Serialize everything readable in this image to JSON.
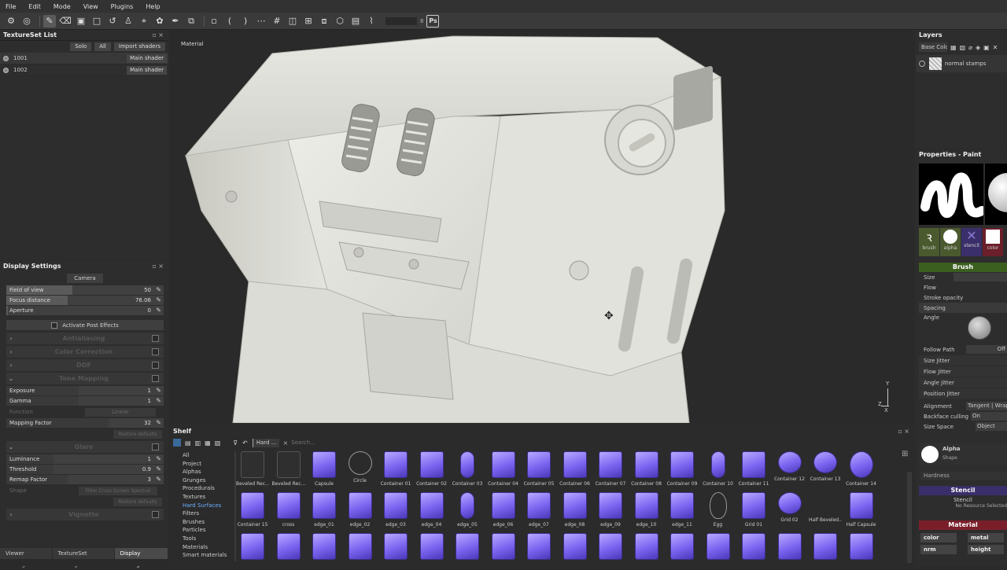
{
  "menu": [
    "File",
    "Edit",
    "Mode",
    "View",
    "Plugins",
    "Help"
  ],
  "toolbar": {
    "ps_label": "Ps",
    "brush_count": "8"
  },
  "textureset": {
    "title": "TextureSet List",
    "solo": "Solo",
    "all": "All",
    "import": "Import shaders",
    "items": [
      {
        "name": "1001",
        "shader": "Main shader"
      },
      {
        "name": "1002",
        "shader": "Main shader"
      }
    ]
  },
  "display": {
    "title": "Display Settings",
    "camera": "Camera",
    "fov": {
      "label": "Field of view",
      "value": "50"
    },
    "focus": {
      "label": "Focus distance",
      "value": "76.06"
    },
    "aperture": {
      "label": "Aperture",
      "value": "0"
    },
    "post_fx": "Activate Post Effects",
    "sections": [
      "Antialiasing",
      "Color Correction",
      "DOF",
      "Tone Mapping"
    ],
    "exposure": {
      "label": "Exposure",
      "value": "1"
    },
    "gamma": {
      "label": "Gamma",
      "value": "1"
    },
    "function_label": "Function",
    "function_value": "Linear",
    "mapping": {
      "label": "Mapping Factor",
      "value": "32"
    },
    "reset1": "Restore defaults",
    "glare": "Glare",
    "luminance": {
      "label": "Luminance",
      "value": "1"
    },
    "threshold": {
      "label": "Threshold",
      "value": "0.9"
    },
    "remap": {
      "label": "Remap Factor",
      "value": "3"
    },
    "shape_label": "Shape",
    "shape_value": "Filter Cross Screen Spectral",
    "reset2": "Restore defaults",
    "vignette": "Vignette"
  },
  "bottom_tabs": [
    "Viewer Settings",
    "TextureSet Settings",
    "Display Settings"
  ],
  "viewport": {
    "label": "Material"
  },
  "shelf": {
    "title": "Shelf",
    "filter": "Hard ...",
    "search_placeholder": "Search...",
    "categories": [
      "All",
      "Project",
      "Alphas",
      "Grunges",
      "Procedurals",
      "Textures",
      "Hard Surfaces",
      "Filters",
      "Brushes",
      "Particles",
      "Tools",
      "Materials",
      "Smart materials"
    ],
    "row1": [
      "Beveled Rec...",
      "Beveled Rec...",
      "Capsule",
      "Circle",
      "Container 01",
      "Container 02",
      "Container 03",
      "Container 04",
      "Container 05",
      "Container 06",
      "Container 07",
      "Container 08",
      "Container 09",
      "Container 10",
      "Container 11",
      "Container 12",
      "Container 13",
      "Container 14"
    ],
    "row2": [
      "Container 15",
      "cross",
      "edge_01",
      "edge_02",
      "edge_03",
      "edge_04",
      "edge_05",
      "edge_06",
      "edge_07",
      "edge_08",
      "edge_09",
      "edge_10",
      "edge_11",
      "Egg",
      "Grid 01",
      "Grid 02",
      "Half Beveled...",
      "Half Capsule"
    ]
  },
  "layers": {
    "title": "Layers",
    "channel": "Base Colc",
    "layer_name": "normal stamps"
  },
  "properties": {
    "title": "Properties - Paint",
    "slots": [
      "brush",
      "alpha",
      "stencil",
      "color"
    ],
    "brush_title": "Brush",
    "rows": [
      "Size",
      "Flow",
      "Stroke opacity",
      "Spacing"
    ],
    "angle": "Angle",
    "follow_path": "Follow Path",
    "follow_val": "Off",
    "jitters": [
      "Size Jitter",
      "Flow Jitter",
      "Angle Jitter",
      "Position Jitter"
    ],
    "alignment": "Alignment",
    "alignment_val": "Tangent | Wrap",
    "backface": "Backface culling",
    "backface_val": "On",
    "size_space": "Size Space",
    "size_space_val": "Object",
    "alpha_name": "Alpha",
    "alpha_sub": "Shape",
    "hardness": "Hardness",
    "stencil_title": "Stencil",
    "stencil_sub": "Stencil",
    "stencil_none": "No Resource Selected",
    "material_title": "Material",
    "channels": [
      "color",
      "metal",
      "nrm",
      "height"
    ]
  }
}
